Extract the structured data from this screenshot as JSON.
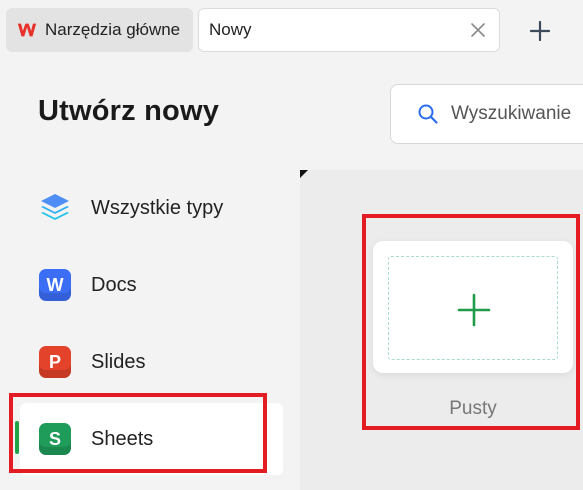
{
  "tabs": {
    "home_label": "Narzędzia główne",
    "new_label": "Nowy"
  },
  "page": {
    "title": "Utwórz nowy"
  },
  "search": {
    "placeholder": "Wyszukiwanie"
  },
  "nav": {
    "items": [
      {
        "label": "Wszystkie typy",
        "icon": "layers-icon"
      },
      {
        "label": "Docs",
        "icon": "docs-icon",
        "badge": "W",
        "color": "#3b6ef5"
      },
      {
        "label": "Slides",
        "icon": "slides-icon",
        "badge": "P",
        "color": "#e2432a"
      },
      {
        "label": "Sheets",
        "icon": "sheets-icon",
        "badge": "S",
        "color": "#1f9b5a"
      }
    ],
    "active": "Sheets"
  },
  "templates": {
    "blank_label": "Pusty"
  },
  "colors": {
    "accent_green": "#20a346",
    "highlight_red": "#e31c24"
  }
}
